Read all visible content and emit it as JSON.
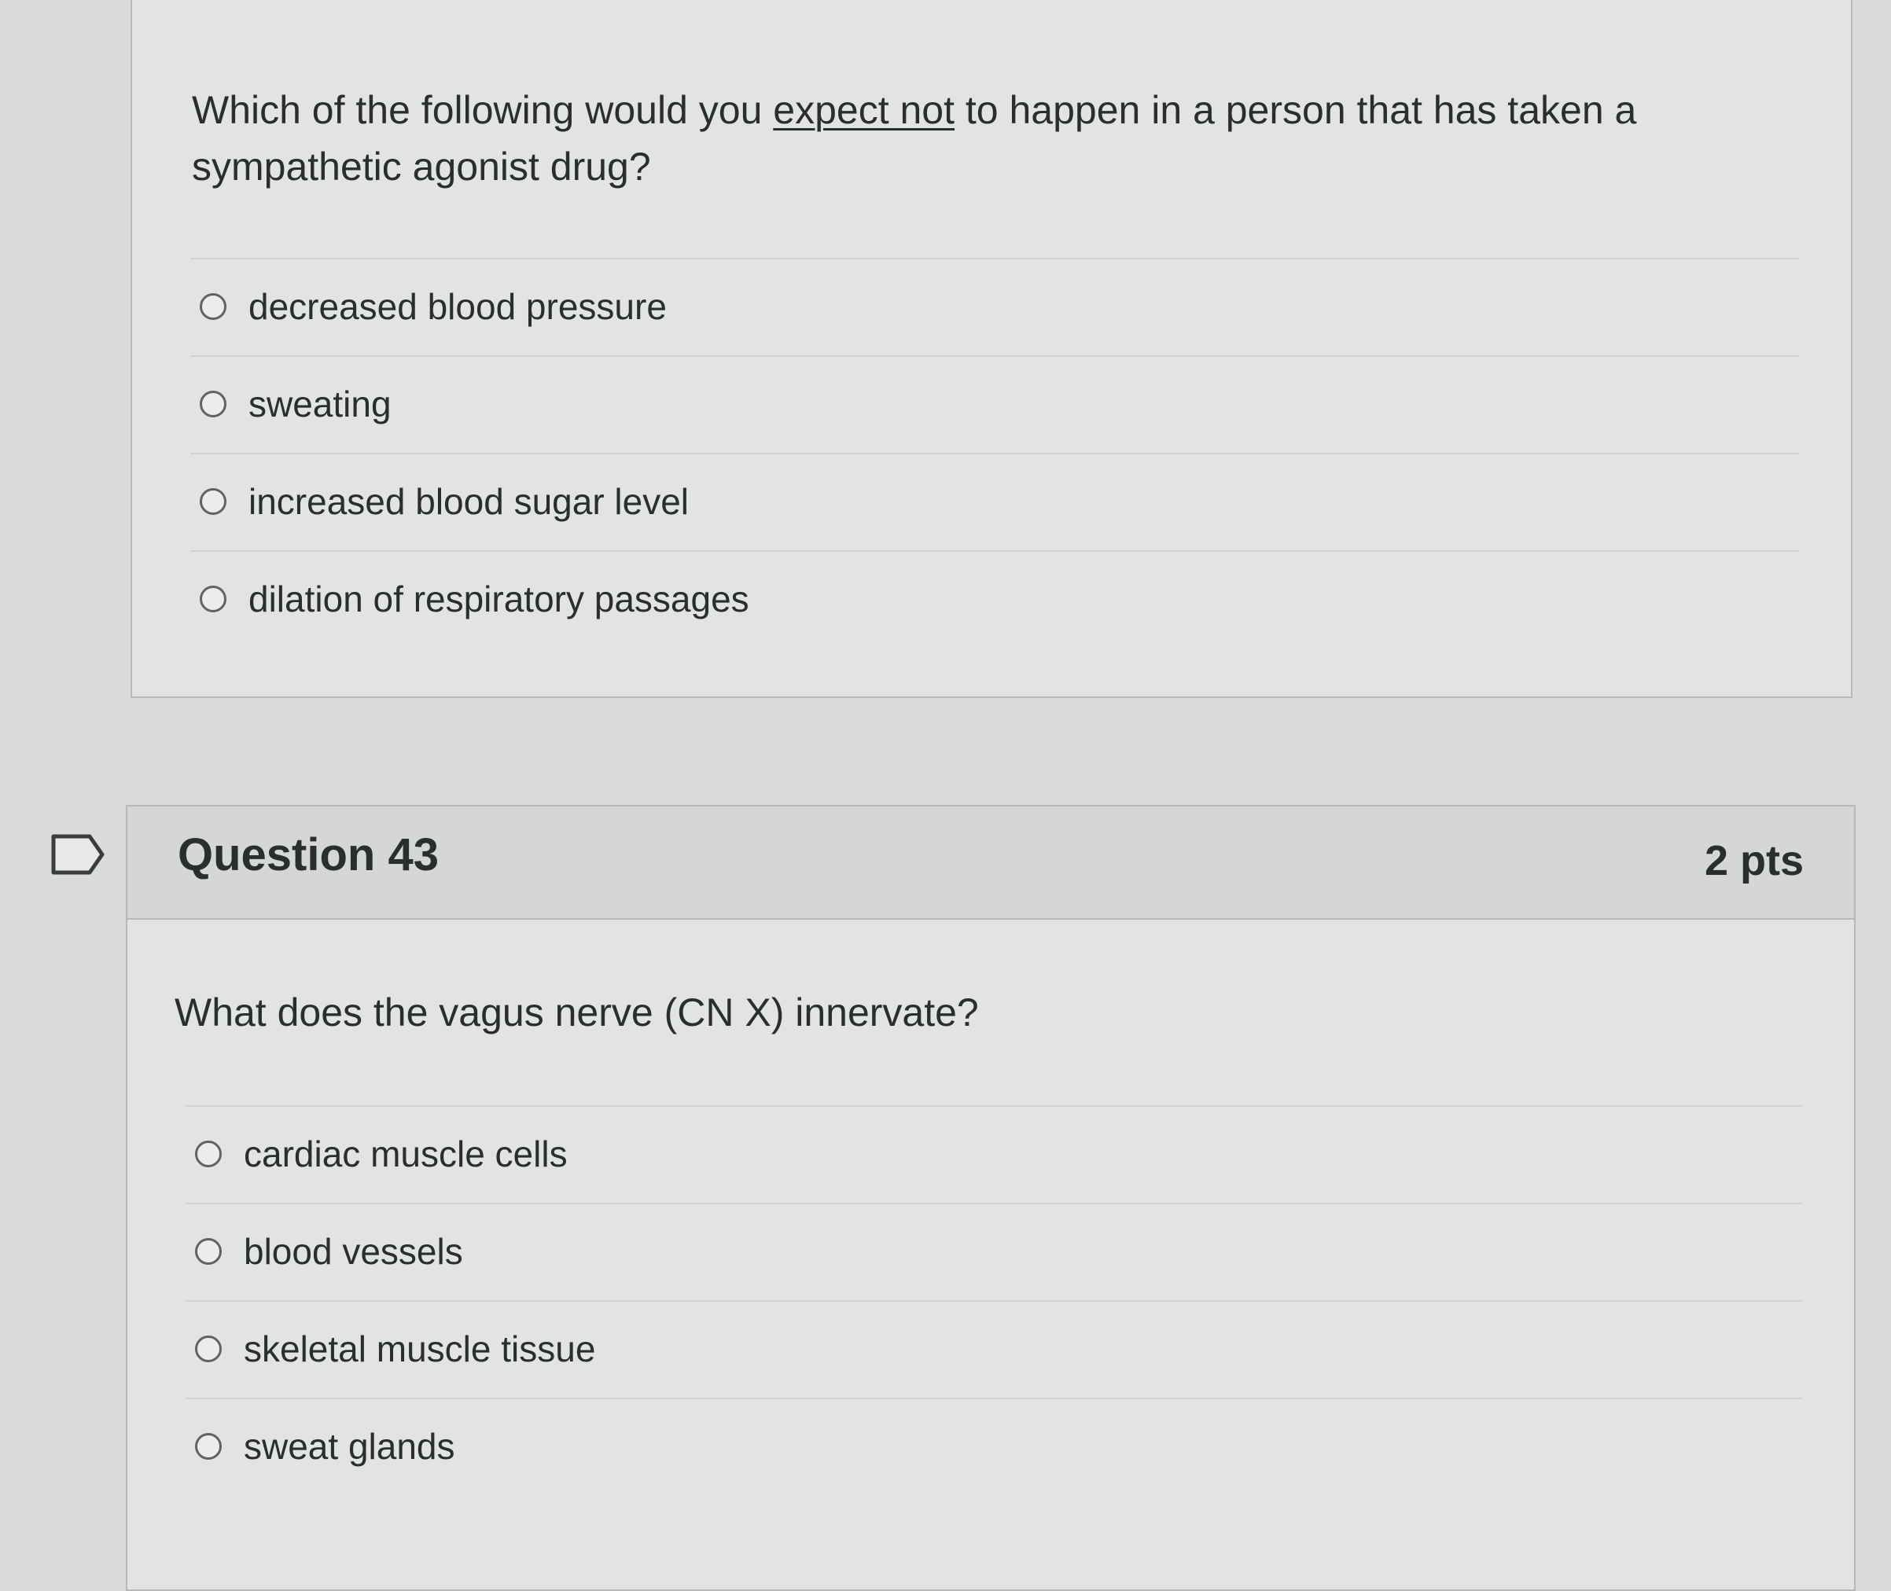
{
  "previous_question": {
    "text_before": "Which of the following would you ",
    "text_emphasis": "expect not",
    "text_after": " to happen in a person that has taken a sympathetic agonist drug?",
    "answers": [
      {
        "label": "decreased blood pressure"
      },
      {
        "label": "sweating"
      },
      {
        "label": "increased blood sugar level"
      },
      {
        "label": "dilation of respiratory passages"
      }
    ]
  },
  "question_43": {
    "title": "Question 43",
    "points": "2 pts",
    "text": "What does the vagus nerve (CN X) innervate?",
    "answers": [
      {
        "label": "cardiac muscle cells"
      },
      {
        "label": "blood vessels"
      },
      {
        "label": "skeletal muscle tissue"
      },
      {
        "label": "sweat glands"
      }
    ]
  },
  "icons": {
    "flag": "flag-icon",
    "radio": "radio-button-icon"
  },
  "colors": {
    "page_background": "#dadcd9",
    "card_background": "#e2e4e1",
    "header_background": "#d5d7d4",
    "border": "#b6b9b6",
    "text": "#2b2e31"
  }
}
